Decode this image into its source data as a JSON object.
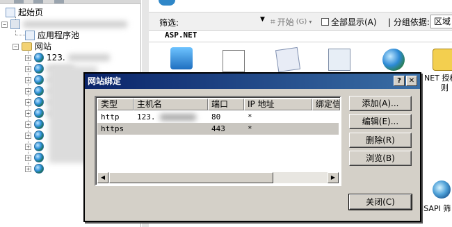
{
  "tree": {
    "items": [
      {
        "label": "起始页",
        "expander": ""
      },
      {
        "label": "",
        "expander": "−"
      },
      {
        "label": "应用程序池",
        "expander": ""
      },
      {
        "label": "网站",
        "expander": "−"
      },
      {
        "label": "123.",
        "expander": "+"
      }
    ],
    "site_expander": "+"
  },
  "toolbar": {
    "filter_label": "筛选:",
    "start_label": "开始",
    "start_hotkey": "(G)",
    "show_all_label": "全部显示(A)",
    "group_by_label": "| 分组依据:",
    "group_value": "区域"
  },
  "features": {
    "section_title": "ASP.NET",
    "net_auth_label_line1": "NET 授权",
    "net_auth_label_line2": "则",
    "isapi_label": "ISAPI 筛"
  },
  "dialog": {
    "title": "网站绑定",
    "help_glyph": "?",
    "close_glyph": "✕",
    "columns": [
      "类型",
      "主机名",
      "端口",
      "IP 地址",
      "绑定信"
    ],
    "rows": [
      {
        "type": "http",
        "host": "123.",
        "port": "80",
        "ip": "*"
      },
      {
        "type": "https",
        "host": "",
        "port": "443",
        "ip": "*"
      }
    ],
    "buttons": {
      "add": "添加(A)...",
      "edit": "编辑(E)...",
      "remove": "删除(R)",
      "browse": "浏览(B)",
      "close": "关闭(C)"
    },
    "scroll_left": "◀",
    "scroll_right": "▶"
  }
}
